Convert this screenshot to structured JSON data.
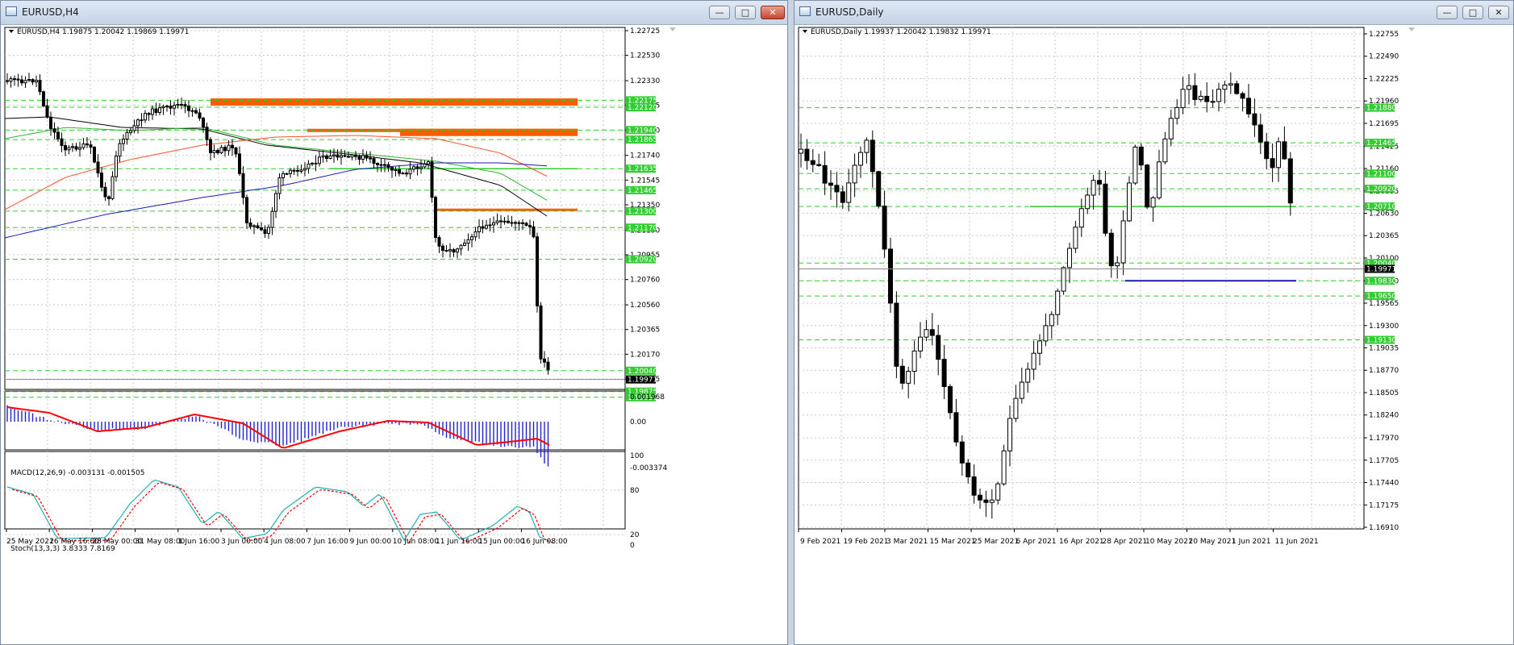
{
  "windows": {
    "h4": {
      "title": "EURUSD,H4",
      "controls": [
        "—",
        "□",
        "✕"
      ]
    },
    "daily": {
      "title": "EURUSD,Daily",
      "controls": [
        "—",
        "□",
        "✕"
      ]
    }
  },
  "colors": {
    "bull": "#ffffff",
    "bear": "#000000",
    "grid": "#c8c8c8",
    "level_green": "#33cc33",
    "zone_orange": "#ff5b00",
    "ma_black": "#000000",
    "ma_green": "#2fb62f",
    "ma_orange": "#ff5030",
    "ma_blue": "#1a1ab8",
    "macd_hist": "#2222cc",
    "macd_signal": "#ff0000",
    "stoch_main": "#20b0b0",
    "stoch_signal": "#ff0000",
    "price_tag": "#000000"
  },
  "h4": {
    "header": "EURUSD,H4  1.19875 1.20042 1.19869 1.19971",
    "price_axis": [
      "1.22725",
      "1.22530",
      "1.22330",
      "1.22135",
      "1.21940",
      "1.21740",
      "1.21545",
      "1.21350",
      "1.21150",
      "1.20955",
      "1.20760",
      "1.20560",
      "1.20365",
      "1.20170",
      "1.19975"
    ],
    "level_labels": [
      {
        "price": 1.22175,
        "text": "1.22175"
      },
      {
        "price": 1.2212,
        "text": "1.22120"
      },
      {
        "price": 1.2194,
        "text": "1.21940"
      },
      {
        "price": 1.21865,
        "text": "1.21865"
      },
      {
        "price": 1.21635,
        "text": "1.21635"
      },
      {
        "price": 1.21465,
        "text": "1.21465"
      },
      {
        "price": 1.213,
        "text": "1.21300"
      },
      {
        "price": 1.2117,
        "text": "1.21170"
      },
      {
        "price": 1.2092,
        "text": "1.20920"
      },
      {
        "price": 1.2004,
        "text": "1.20040"
      },
      {
        "price": 1.19875,
        "text": "1.19875"
      },
      {
        "price": 1.1983,
        "text": "1.19830"
      }
    ],
    "current_price": "1.19971",
    "time_axis": [
      "25 May 2021",
      "26 May 16:00",
      "28 May 00:00",
      "31 May 08:00",
      "1 Jun 16:00",
      "3 Jun 00:00",
      "4 Jun 08:00",
      "7 Jun 16:00",
      "9 Jun 00:00",
      "10 Jun 08:00",
      "11 Jun 16:00",
      "15 Jun 00:00",
      "16 Jun 08:00"
    ],
    "macd": {
      "header": "MACD(12,26,9) -0.003131 -0.001505",
      "axis": [
        "0.001968",
        "0.00",
        "-0.003374"
      ]
    },
    "stoch": {
      "header": "Stoch(13,3,3) 3.8333 7.8169",
      "axis": [
        "100",
        "80",
        "20",
        "0"
      ]
    }
  },
  "daily": {
    "header": "EURUSD,Daily  1.19937 1.20042 1.19832 1.19971",
    "price_axis": [
      "1.22755",
      "1.22490",
      "1.22225",
      "1.21960",
      "1.21695",
      "1.21425",
      "1.21160",
      "1.20895",
      "1.20630",
      "1.20365",
      "1.20100",
      "1.19830",
      "1.19565",
      "1.19300",
      "1.19035",
      "1.18770",
      "1.18505",
      "1.18240",
      "1.17970",
      "1.17705",
      "1.17440",
      "1.17175",
      "1.16910"
    ],
    "level_labels": [
      {
        "price": 1.2188,
        "text": "1.21880"
      },
      {
        "price": 1.21465,
        "text": "1.21465"
      },
      {
        "price": 1.211,
        "text": "1.21100"
      },
      {
        "price": 1.2092,
        "text": "1.20920"
      },
      {
        "price": 1.2071,
        "text": "1.20710"
      },
      {
        "price": 1.2004,
        "text": "1.20040"
      },
      {
        "price": 1.1983,
        "text": "1.19830"
      },
      {
        "price": 1.1965,
        "text": "1.19650"
      },
      {
        "price": 1.1913,
        "text": "1.19130"
      }
    ],
    "current_price": "1.19971",
    "time_axis": [
      "9 Feb 2021",
      "19 Feb 2021",
      "3 Mar 2021",
      "15 Mar 2021",
      "25 Mar 2021",
      "6 Apr 2021",
      "16 Apr 2021",
      "28 Apr 2021",
      "10 May 2021",
      "20 May 2021",
      "1 Jun 2021",
      "11 Jun 2021"
    ]
  }
}
